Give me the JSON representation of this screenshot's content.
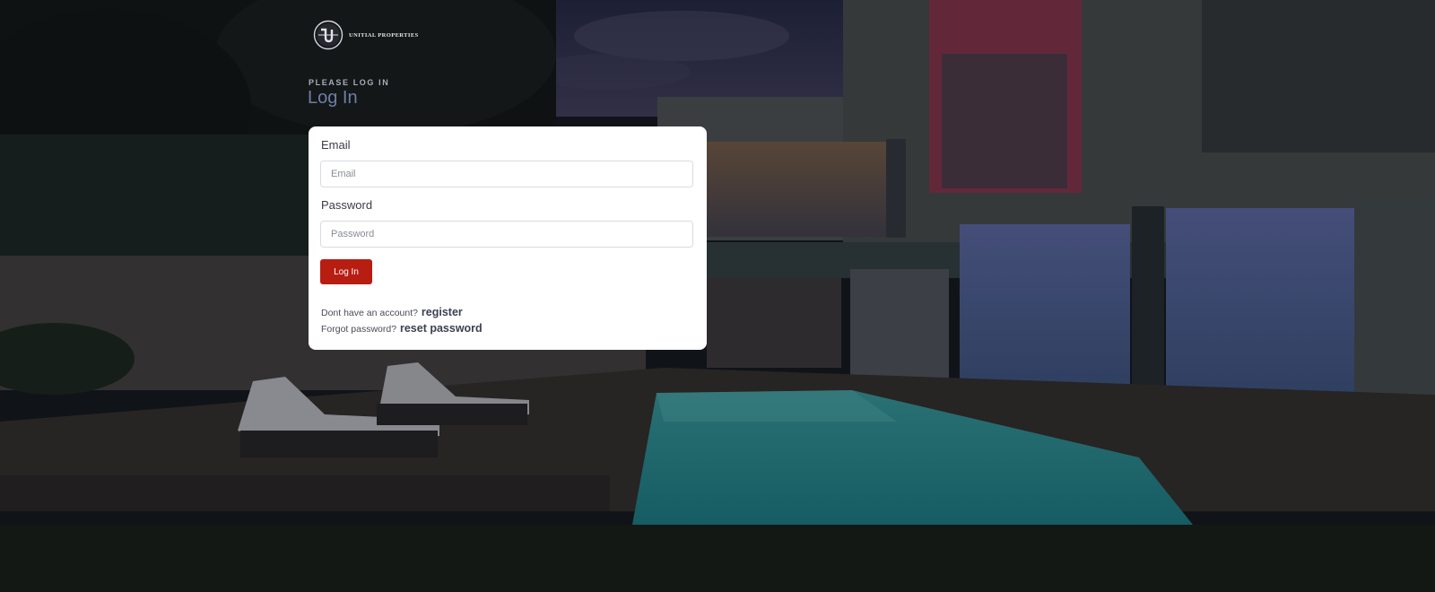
{
  "brand": {
    "name": "UNITIAL PROPERTIES"
  },
  "header": {
    "eyebrow": "PLEASE LOG IN",
    "title": "Log In"
  },
  "form": {
    "email_label": "Email",
    "email_placeholder": "Email",
    "email_value": "",
    "password_label": "Password",
    "password_placeholder": "Password",
    "password_value": "",
    "submit_label": "Log In"
  },
  "links": {
    "register_prompt": "Dont have an account?",
    "register_label": "register",
    "reset_prompt": "Forgot password?",
    "reset_label": "reset password"
  },
  "colors": {
    "primary_button": "#b81d12",
    "card_background": "#ffffff",
    "title": "#6f7ea6"
  },
  "icons": {
    "logo": "unitial-logo-icon"
  }
}
